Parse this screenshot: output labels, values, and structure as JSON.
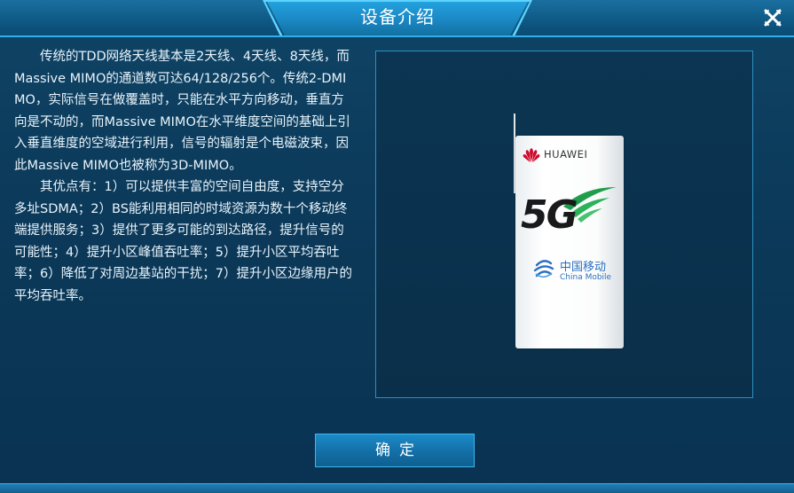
{
  "dialog": {
    "title": "设备介绍",
    "close_icon": "close-icon"
  },
  "description": {
    "paragraphs": [
      "传统的TDD网络天线基本是2天线、4天线、8天线，而Massive MIMO的通道数可达64/128/256个。传统2-DMIMO，实际信号在做覆盖时，只能在水平方向移动，垂直方向是不动的，而Massive MIMO在水平维度空间的基础上引入垂直维度的空域进行利用，信号的辐射是个电磁波束，因此Massive MIMO也被称为3D-MIMO。",
      "其优点有：1）可以提供丰富的空间自由度，支持空分多址SDMA；2）BS能利用相同的时域资源为数十个移动终端提供服务；3）提供了更多可能的到达路径，提升信号的可能性；4）提升小区峰值吞吐率；5）提升小区平均吞吐率；6）降低了对周边基站的干扰；7）提升小区边缘用户的平均吞吐率。"
    ]
  },
  "device_image": {
    "brand": "HUAWEI",
    "network": "5G",
    "operator_cn": "中国移动",
    "operator_en": "China Mobile"
  },
  "buttons": {
    "confirm_label": "确定"
  },
  "colors": {
    "accent": "#23a4df",
    "panel_border": "#2d8fc0",
    "huawei_red": "#cf0a2c",
    "fiveg_green": "#1e9e4a",
    "china_mobile_blue": "#2a6fc1"
  }
}
